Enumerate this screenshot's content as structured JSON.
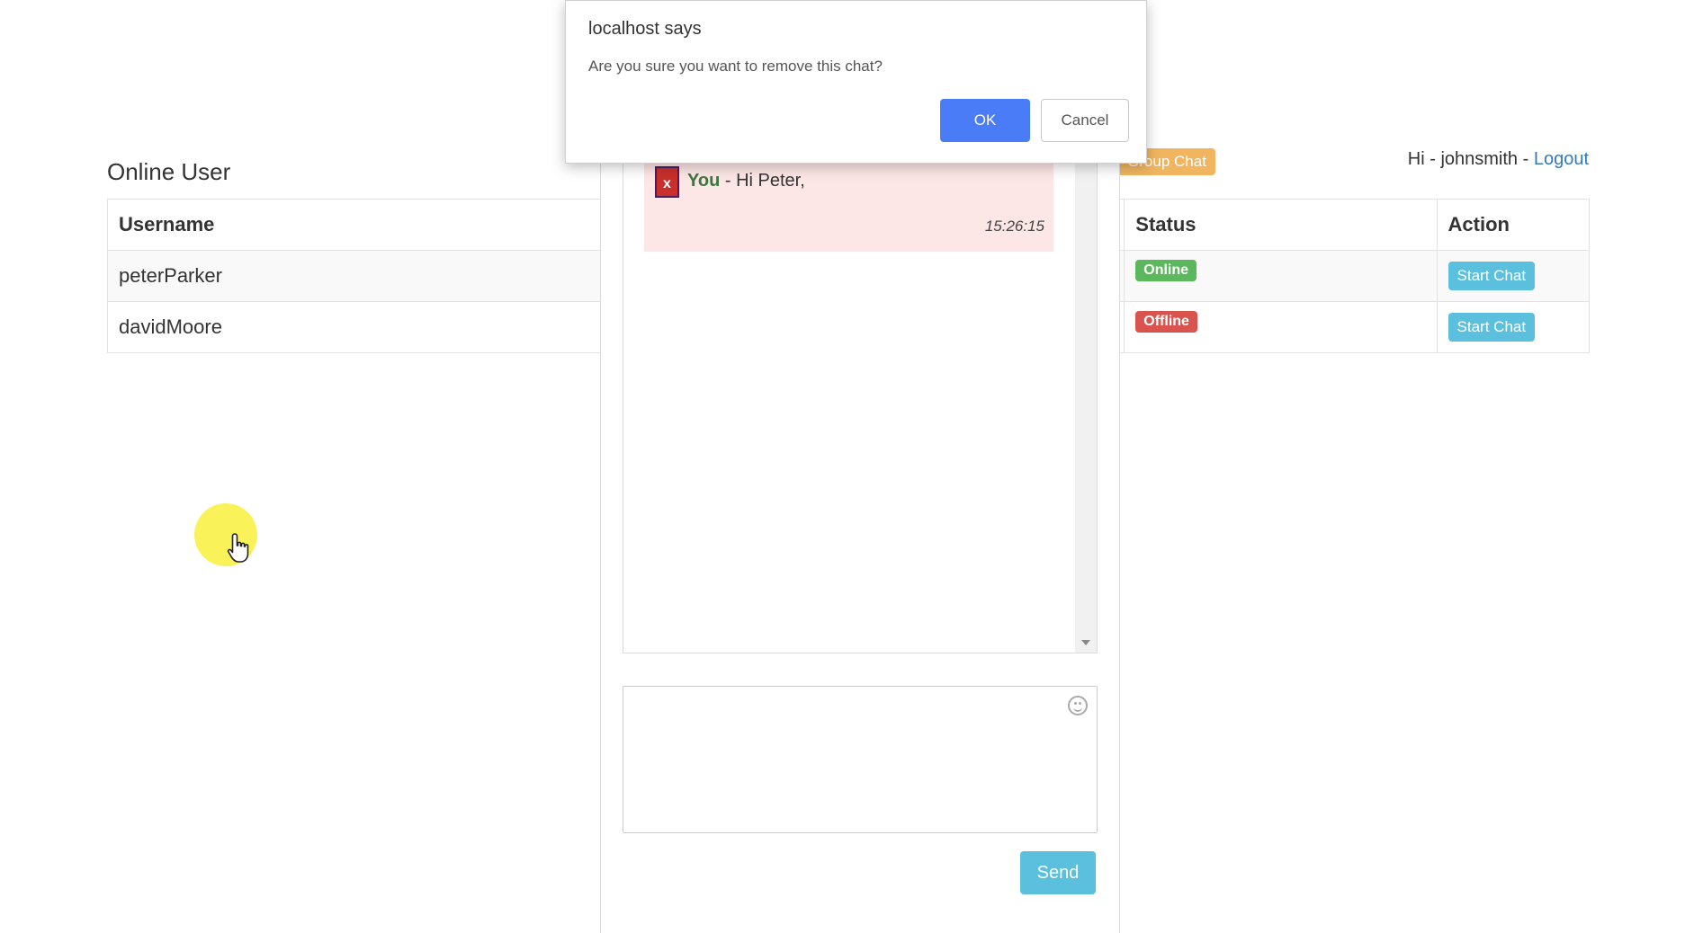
{
  "header": {
    "title": "Online User",
    "greeting_prefix": "Hi - ",
    "username": "johnsmith",
    "separator": " - ",
    "logout_label": "Logout",
    "group_chat_label": "Group Chat"
  },
  "table": {
    "columns": [
      "Username",
      "Status",
      "Action"
    ],
    "rows": [
      {
        "username": "peterParker",
        "status": "Online",
        "action": "Start Chat"
      },
      {
        "username": "davidMoore",
        "status": "Offline",
        "action": "Start Chat"
      }
    ]
  },
  "chat": {
    "messages": [
      {
        "remove_label": "x",
        "sender": "You",
        "text": " - Hi Peter,",
        "time": "15:26:15"
      }
    ],
    "send_label": "Send",
    "emoji_icon": "smiley-icon"
  },
  "dialog": {
    "title": "localhost says",
    "message": "Are you sure you want to remove this chat?",
    "ok_label": "OK",
    "cancel_label": "Cancel"
  },
  "colors": {
    "online": "#5cb85c",
    "offline": "#d9534f",
    "start_chat": "#5bc0de",
    "group_chat": "#f0ad4e",
    "ok_button": "#4a7cf7",
    "message_bg": "#fde6e6"
  }
}
